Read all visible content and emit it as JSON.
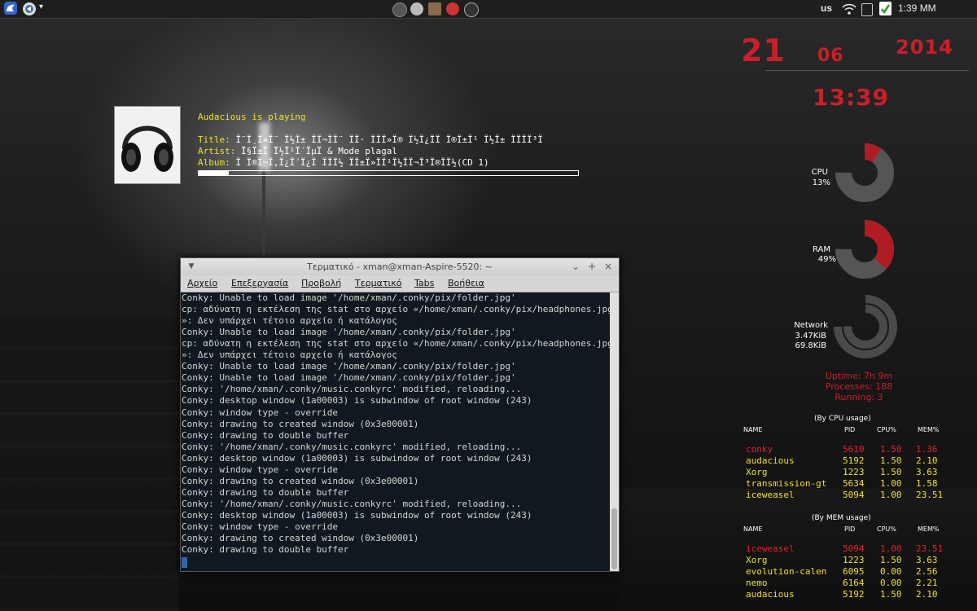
{
  "panel": {
    "keyboard_layout": "us",
    "clock": "1:39 ΜΜ",
    "menu_arrow": "▾"
  },
  "conky": {
    "day": "21",
    "month": "06",
    "year": "2014",
    "time": "13:39",
    "cpu": {
      "label": "CPU",
      "value": "13%",
      "percent": 13
    },
    "ram": {
      "label": "RAM",
      "value": "49%",
      "percent": 49
    },
    "network": {
      "label": "Network",
      "up": "3.47KiB",
      "down": "69.8KiB"
    },
    "uptime": "Uptime: 7h 9m",
    "processes": "Processes: 188",
    "running": "Running: 3",
    "accent_color": "#c8202a"
  },
  "music": {
    "status": "Audacious is playing",
    "title_label": "Title: ",
    "title_value": "Ï¨Ï¸Ï»Ï¨ Ï½Ï± ÏÏ¬ÏÏ¨ ÏÏ· ÏÏÏ»Ï® Ï½Ï¿ÏÏ Ï®Ï±Ï¹ Ï½Ï± ÏÏÏÏ³Ï",
    "artist_label": "Artist: ",
    "artist_value": "Ï§Ï±Ï Ï½Ï¹Ï´ÏµÏ & Mode plagal",
    "album_label": "Album: ",
    "album_value": "Ï Ï®Ï¬Ï,Ï¿Ï´Ï¿Ï ÏÏÏ½ ÏÏ±Ï»ÏÏ¹Ï½ÏÏ¬Ï³Ï®ÏÏ½(CD 1)",
    "progress": 0.08
  },
  "process_cpu": {
    "title": "(By CPU usage)",
    "headers": [
      "NAME",
      "PID",
      "CPU%",
      "MEM%"
    ],
    "rows": [
      {
        "name": "conky",
        "pid": "5610",
        "cpu": "1.50",
        "mem": "1.36"
      },
      {
        "name": "audacious",
        "pid": "5192",
        "cpu": "1.50",
        "mem": "2.10"
      },
      {
        "name": "Xorg",
        "pid": "1223",
        "cpu": "1.50",
        "mem": "3.63"
      },
      {
        "name": "transmission-gt",
        "pid": "5634",
        "cpu": "1.00",
        "mem": "1.58"
      },
      {
        "name": "iceweasel",
        "pid": "5094",
        "cpu": "1.00",
        "mem": "23.51"
      }
    ]
  },
  "process_mem": {
    "title": "(By MEM usage)",
    "headers": [
      "NAME",
      "PID",
      "CPU%",
      "MEM%"
    ],
    "rows": [
      {
        "name": "iceweasel",
        "pid": "5094",
        "cpu": "1.00",
        "mem": "23.51"
      },
      {
        "name": "Xorg",
        "pid": "1223",
        "cpu": "1.50",
        "mem": "3.63"
      },
      {
        "name": "evolution-calen",
        "pid": "6095",
        "cpu": "0.00",
        "mem": "2.56"
      },
      {
        "name": "nemo",
        "pid": "6164",
        "cpu": "0.00",
        "mem": "2.21"
      },
      {
        "name": "audacious",
        "pid": "5192",
        "cpu": "1.50",
        "mem": "2.10"
      }
    ]
  },
  "terminal": {
    "title": "Τερματικό - xman@xman-Aspire-5520: ~",
    "menu": [
      "Αρχείο",
      "Επεξεργασία",
      "Προβολή",
      "Τερματικό",
      "Tabs",
      "Βοήθεια"
    ],
    "lines": [
      "Conky: Unable to load image '/home/xman/.conky/pix/folder.jpg'",
      "cp: αδύνατη η εκτέλεση της stat στο αρχείο «/home/xman/.conky/pix/headphones.jpg",
      "»: Δεν υπάρχει τέτοιο αρχείο ή κατάλογος",
      "Conky: Unable to load image '/home/xman/.conky/pix/folder.jpg'",
      "cp: αδύνατη η εκτέλεση της stat στο αρχείο «/home/xman/.conky/pix/headphones.jpg",
      "»: Δεν υπάρχει τέτοιο αρχείο ή κατάλογος",
      "Conky: Unable to load image '/home/xman/.conky/pix/folder.jpg'",
      "Conky: Unable to load image '/home/xman/.conky/pix/folder.jpg'",
      "Conky: '/home/xman/.conky/music.conkyrc' modified, reloading...",
      "Conky: desktop window (1a00003) is subwindow of root window (243)",
      "Conky: window type - override",
      "Conky: drawing to created window (0x3e00001)",
      "Conky: drawing to double buffer",
      "Conky: '/home/xman/.conky/music.conkyrc' modified, reloading...",
      "Conky: desktop window (1a00003) is subwindow of root window (243)",
      "Conky: window type - override",
      "Conky: drawing to created window (0x3e00001)",
      "Conky: drawing to double buffer",
      "Conky: '/home/xman/.conky/music.conkyrc' modified, reloading...",
      "Conky: desktop window (1a00003) is subwindow of root window (243)",
      "Conky: window type - override",
      "Conky: drawing to created window (0x3e00001)",
      "Conky: drawing to double buffer"
    ]
  }
}
